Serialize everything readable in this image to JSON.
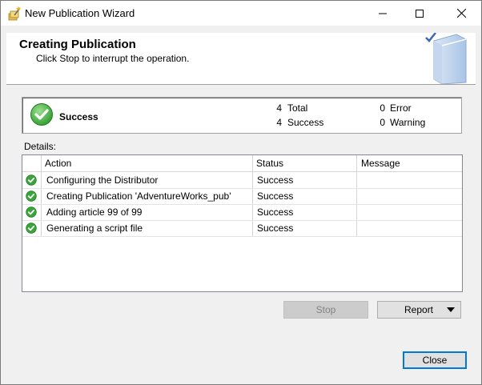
{
  "window": {
    "title": "New Publication Wizard"
  },
  "banner": {
    "title": "Creating Publication",
    "subtitle": "Click Stop to interrupt the operation."
  },
  "status": {
    "label": "Success",
    "total_count": "4",
    "total_label": "Total",
    "success_count": "4",
    "success_label": "Success",
    "error_count": "0",
    "error_label": "Error",
    "warning_count": "0",
    "warning_label": "Warning"
  },
  "details": {
    "label": "Details:",
    "columns": [
      "Action",
      "Status",
      "Message"
    ],
    "rows": [
      {
        "action": "Configuring the Distributor",
        "status": "Success",
        "message": ""
      },
      {
        "action": "Creating Publication 'AdventureWorks_pub'",
        "status": "Success",
        "message": ""
      },
      {
        "action": "Adding article 99 of 99",
        "status": "Success",
        "message": ""
      },
      {
        "action": "Generating a script file",
        "status": "Success",
        "message": ""
      }
    ]
  },
  "buttons": {
    "stop": "Stop",
    "report": "Report",
    "close": "Close"
  },
  "colors": {
    "success_green": "#3ca43c",
    "focus_blue": "#0078d7"
  },
  "icons": {
    "app": "wizard-wand-icon",
    "status": "check-circle-icon",
    "row_status": "check-circle-icon"
  }
}
